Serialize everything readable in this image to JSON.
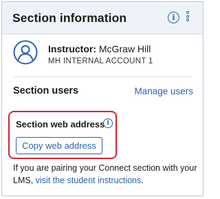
{
  "header": {
    "title": "Section information",
    "info_icon": "info-icon",
    "menu_icon": "kebab-menu-icon"
  },
  "instructor": {
    "label": "Instructor:",
    "name": "McGraw Hill",
    "account": "MH INTERNAL ACCOUNT 1",
    "avatar_icon": "user-avatar-icon"
  },
  "section_users": {
    "title": "Section users",
    "manage_link": "Manage users"
  },
  "web_address": {
    "title": "Section web address",
    "info_icon": "info-icon",
    "copy_button": "Copy web address"
  },
  "note": {
    "text": "If you are pairing your Connect section with your LMS,",
    "link": "visit the student instructions",
    "end": "."
  },
  "colors": {
    "accent": "#2b63ad",
    "highlight": "#d32331",
    "header_bg": "#eef3f9"
  }
}
